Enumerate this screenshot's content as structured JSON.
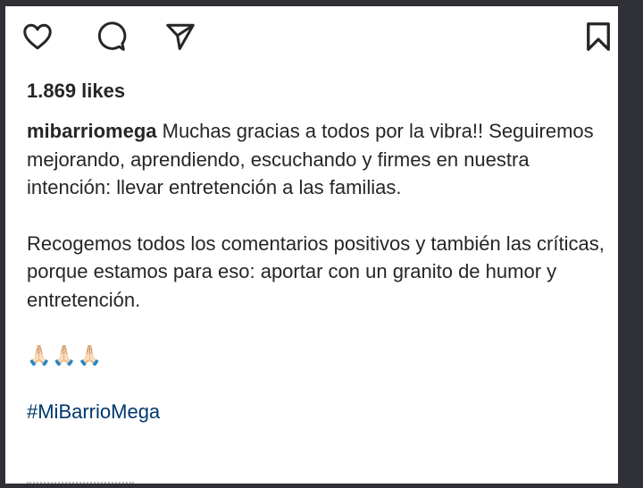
{
  "actions": {
    "like_icon": "heart-outline",
    "comment_icon": "speech-bubble-outline",
    "share_icon": "paper-plane-outline",
    "save_icon": "bookmark-outline"
  },
  "likes": "1.869 likes",
  "caption": {
    "username": "mibarriomega",
    "paragraph1": "Muchas gracias a todos por la vibra!! Seguiremos mejorando, aprendiendo, escuchando y firmes en nuestra intención: llevar entretención a las familias.",
    "paragraph2": "Recogemos todos los comentarios positivos y también las críticas, porque estamos para eso: aportar con un granito de humor y entretención.",
    "emojis": "🙏🏻🙏🏻🙏🏻",
    "hashtag": "#MiBarrioMega"
  },
  "colors": {
    "frame": "#2f3136",
    "text": "#262626",
    "hashtag": "#00376b"
  }
}
